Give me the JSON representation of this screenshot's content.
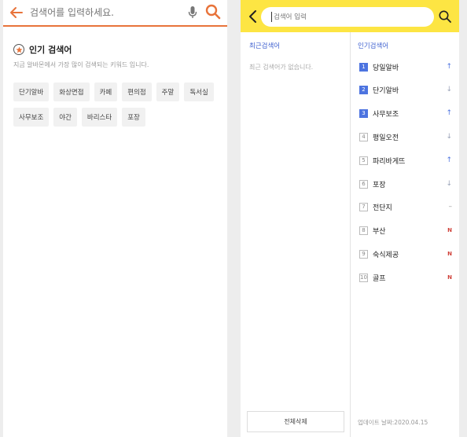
{
  "left": {
    "search_placeholder": "검색어를 입력하세요.",
    "popular_title": "인기 검색어",
    "popular_subtitle": "지금 알바몬에서 가장 많이 검색되는 키워드 입니다.",
    "chips": [
      "단기알바",
      "화상면접",
      "카페",
      "편의점",
      "주말",
      "독서실",
      "사무보조",
      "야간",
      "바리스타",
      "포장"
    ],
    "accent_color": "#e8733a"
  },
  "right": {
    "search_placeholder": "검색어 입력",
    "recent_title": "최근검색어",
    "recent_empty": "최근 검색어가 없습니다.",
    "delete_all_label": "전체삭제",
    "ranking_title": "인기검색어",
    "ranking": [
      {
        "rank": "1",
        "word": "당일알바",
        "trend": "up"
      },
      {
        "rank": "2",
        "word": "단기알바",
        "trend": "down"
      },
      {
        "rank": "3",
        "word": "사무보조",
        "trend": "up"
      },
      {
        "rank": "4",
        "word": "평일오전",
        "trend": "down"
      },
      {
        "rank": "5",
        "word": "파리바게뜨",
        "trend": "up"
      },
      {
        "rank": "6",
        "word": "포장",
        "trend": "down"
      },
      {
        "rank": "7",
        "word": "전단지",
        "trend": "same"
      },
      {
        "rank": "8",
        "word": "부산",
        "trend": "new"
      },
      {
        "rank": "9",
        "word": "숙식제공",
        "trend": "new"
      },
      {
        "rank": "10",
        "word": "골프",
        "trend": "new"
      }
    ],
    "update_label": "업데이트 날짜:2020.04.15",
    "accent_color": "#fde543",
    "rank_highlight_color": "#4d74e0"
  }
}
